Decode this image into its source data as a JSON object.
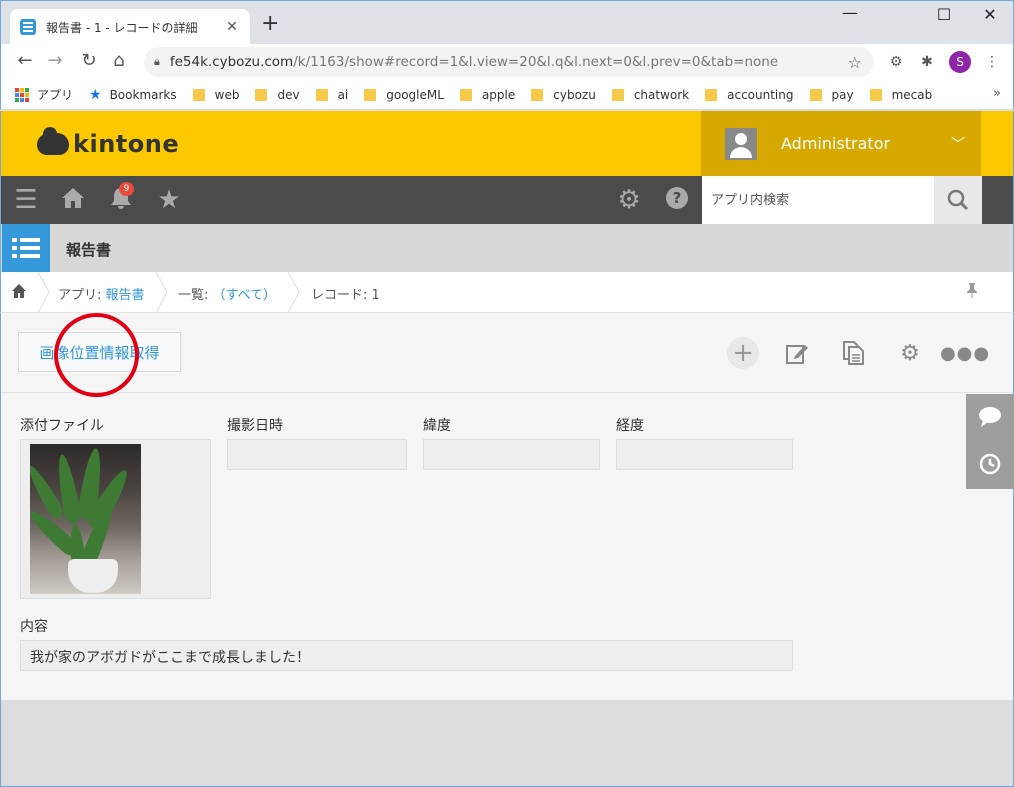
{
  "browser": {
    "tab_title": "報告書 - 1 - レコードの詳細",
    "tab_close": "✕",
    "new_tab": "+",
    "url_host": "fe54k.cybozu.com",
    "url_path": "/k/1163/show#record=1&l.view=20&l.q&l.next=0&l.prev=0&tab=none",
    "profile_initial": "S",
    "bookmarks": [
      "アプリ",
      "Bookmarks",
      "web",
      "dev",
      "ai",
      "googleML",
      "apple",
      "cybozu",
      "chatwork",
      "accounting",
      "pay",
      "mecab"
    ],
    "bookmarks_more": "»"
  },
  "header": {
    "logo_text": "kintone",
    "user_name": "Administrator"
  },
  "nav": {
    "notification_count": "9",
    "search_placeholder": "アプリ内検索"
  },
  "app": {
    "title": "報告書"
  },
  "breadcrumb": {
    "app_prefix": "アプリ: ",
    "app_name": "報告書",
    "list_prefix": "一覧: ",
    "list_name": "（すべて）",
    "record": "レコード: 1"
  },
  "actions": {
    "custom_button_label": "画像位置情報取得"
  },
  "fields": {
    "attachment_label": "添付ファイル",
    "shot_datetime_label": "撮影日時",
    "latitude_label": "緯度",
    "longitude_label": "経度",
    "shot_datetime_value": "",
    "latitude_value": "",
    "longitude_value": "",
    "content_label": "内容",
    "content_value": "我が家のアボガドがここまで成長しました！"
  },
  "colors": {
    "brand_yellow": "#fcc800",
    "nav_dark": "#4b4b4b",
    "accent_blue": "#3498db",
    "annotation_red": "#e00012"
  }
}
